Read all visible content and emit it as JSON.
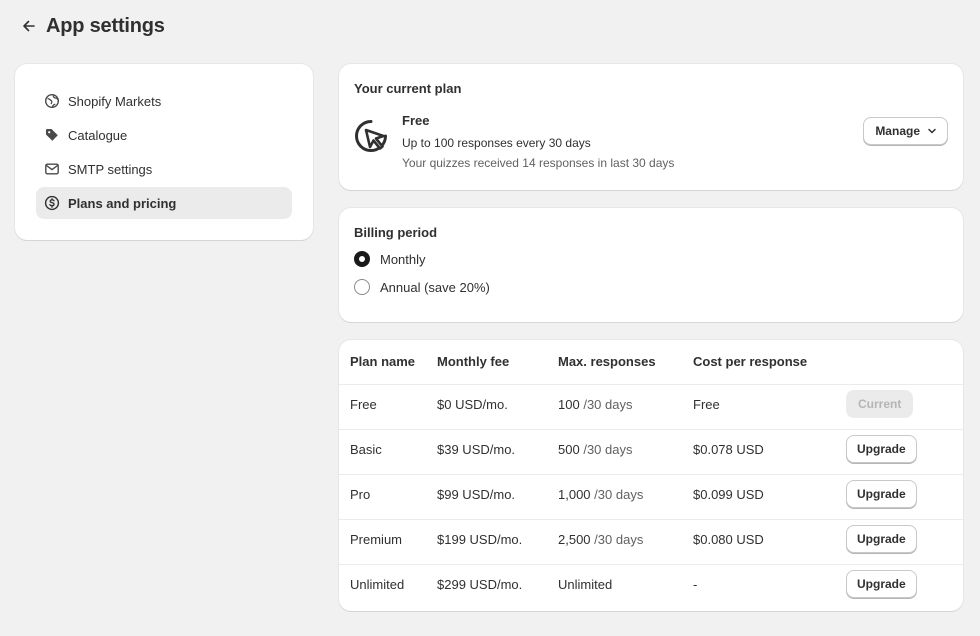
{
  "header": {
    "title": "App settings",
    "back_icon": "arrow-left-icon"
  },
  "sidebar": {
    "items": [
      {
        "label": "Shopify Markets",
        "icon": "globe-icon",
        "active": false
      },
      {
        "label": "Catalogue",
        "icon": "tag-icon",
        "active": false
      },
      {
        "label": "SMTP settings",
        "icon": "envelope-icon",
        "active": false
      },
      {
        "label": "Plans and pricing",
        "icon": "dollar-circle-icon",
        "active": true
      }
    ]
  },
  "current_plan": {
    "title": "Your current plan",
    "plan_name": "Free",
    "line1": "Up to 100 responses every 30 days",
    "line2": "Your quizzes received 14 responses in last 30 days",
    "manage_label": "Manage"
  },
  "billing": {
    "title": "Billing period",
    "options": [
      {
        "label": "Monthly",
        "selected": true
      },
      {
        "label": "Annual (save 20%)",
        "selected": false
      }
    ]
  },
  "plans_table": {
    "headers": [
      "Plan name",
      "Monthly fee",
      "Max. responses",
      "Cost per response",
      ""
    ],
    "rows": [
      {
        "name": "Free",
        "fee": "$0 USD/mo.",
        "responses": "100",
        "period": "/30 days",
        "cost": "Free",
        "action": "Current",
        "action_state": "disabled"
      },
      {
        "name": "Basic",
        "fee": "$39 USD/mo.",
        "responses": "500",
        "period": "/30 days",
        "cost": "$0.078 USD",
        "action": "Upgrade",
        "action_state": "enabled"
      },
      {
        "name": "Pro",
        "fee": "$99 USD/mo.",
        "responses": "1,000",
        "period": "/30 days",
        "cost": "$0.099 USD",
        "action": "Upgrade",
        "action_state": "enabled"
      },
      {
        "name": "Premium",
        "fee": "$199 USD/mo.",
        "responses": "2,500",
        "period": "/30 days",
        "cost": "$0.080 USD",
        "action": "Upgrade",
        "action_state": "enabled"
      },
      {
        "name": "Unlimited",
        "fee": "$299 USD/mo.",
        "responses": "Unlimited",
        "period": "",
        "cost": "-",
        "action": "Upgrade",
        "action_state": "enabled"
      }
    ]
  },
  "colors": {
    "background": "#f1f1f1",
    "card": "#ffffff",
    "active_nav": "#ebebeb",
    "text": "#303030"
  }
}
